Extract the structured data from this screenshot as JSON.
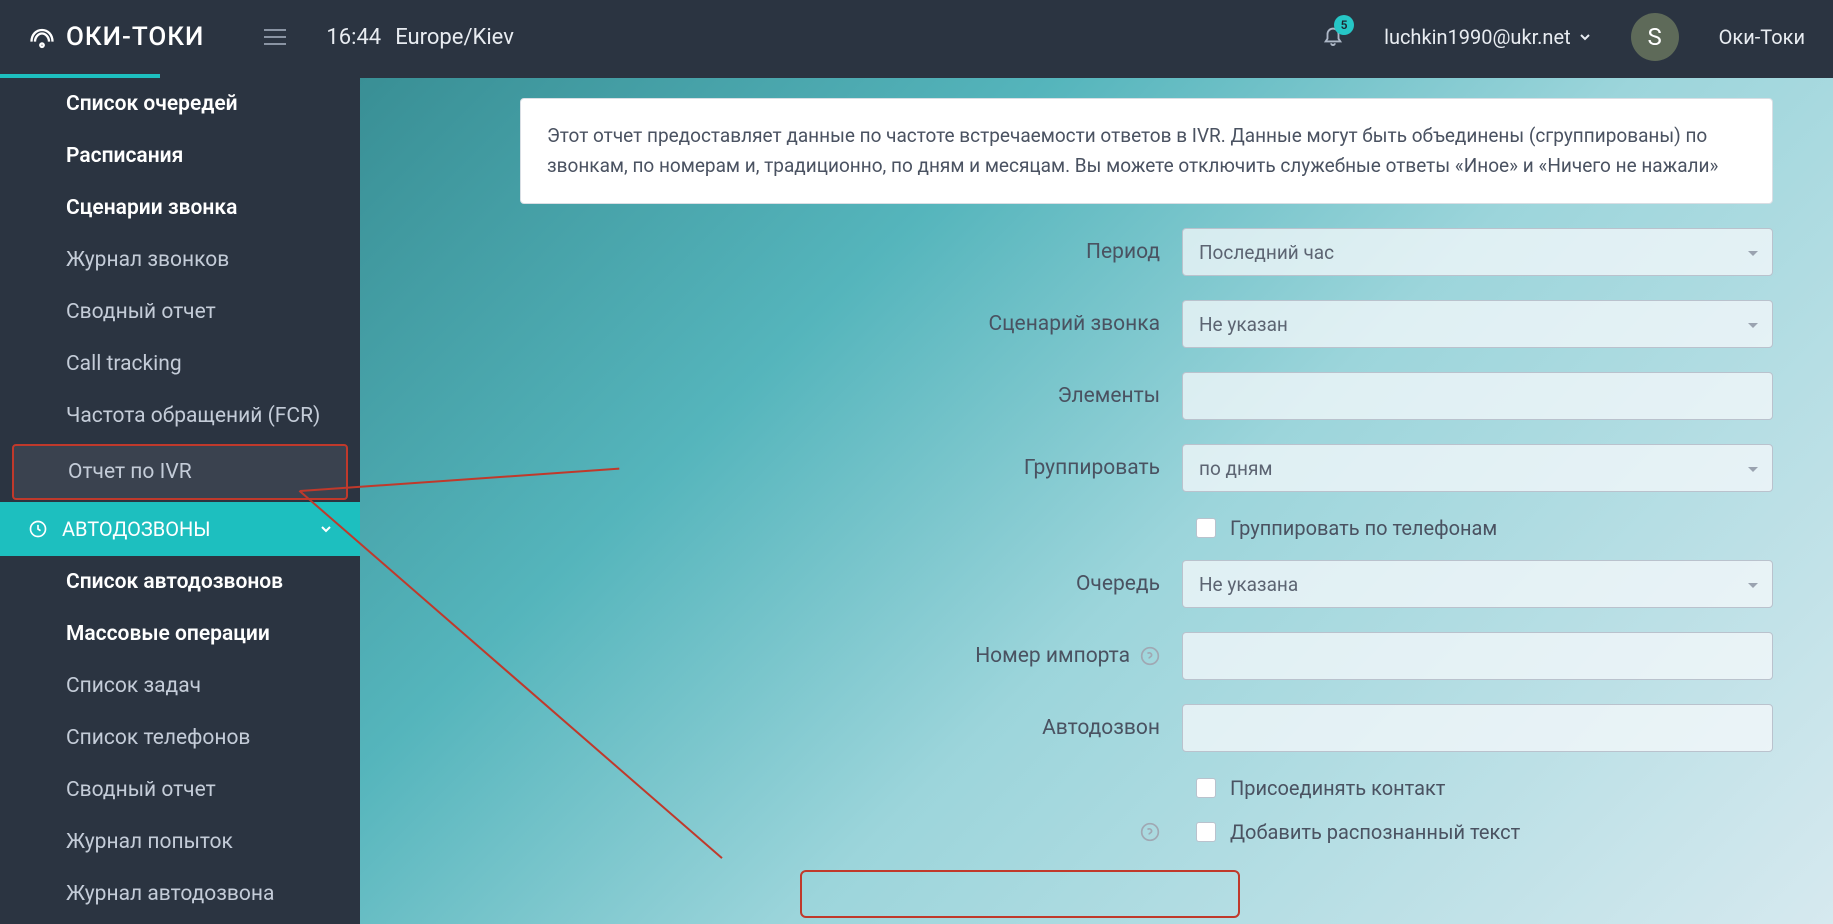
{
  "header": {
    "logo_text": "ОКИ-ТОКИ",
    "time": "16:44",
    "timezone": "Europe/Kiev",
    "badge_count": "5",
    "user_email": "luchkin1990@ukr.net",
    "avatar_letter": "S",
    "company": "Оки-Токи"
  },
  "sidebar": {
    "items": [
      {
        "label": "Список очередей",
        "bold": true
      },
      {
        "label": "Расписания",
        "bold": true
      },
      {
        "label": "Сценарии звонка",
        "bold": true
      },
      {
        "label": "Журнал звонков",
        "bold": false
      },
      {
        "label": "Сводный отчет",
        "bold": false
      },
      {
        "label": "Call tracking",
        "bold": false
      },
      {
        "label": "Частота обращений (FCR)",
        "bold": false
      },
      {
        "label": "Отчет по IVR",
        "bold": false,
        "highlight": true
      }
    ],
    "group_title": "АВТОДОЗВОНЫ",
    "items2": [
      {
        "label": "Список автодозвонов",
        "bold": true
      },
      {
        "label": "Массовые операции",
        "bold": true
      },
      {
        "label": "Список задач",
        "bold": false
      },
      {
        "label": "Список телефонов",
        "bold": false
      },
      {
        "label": "Сводный отчет",
        "bold": false
      },
      {
        "label": "Журнал попыток",
        "bold": false
      },
      {
        "label": "Журнал автодозвона",
        "bold": false
      }
    ]
  },
  "info_text": "Этот отчет предоставляет данные по частоте встречаемости ответов в IVR. Данные могут быть объединены (сгруппированы) по звонкам, по номерам и, традиционно, по дням и месяцам. Вы можете отключить служебные ответы «Иное» и «Ничего не нажали»",
  "form": {
    "period_label": "Период",
    "period_value": "Последний час",
    "scenario_label": "Сценарий звонка",
    "scenario_value": "Не указан",
    "elements_label": "Элементы",
    "group_label": "Группировать",
    "group_value": "по дням",
    "group_phone_label": "Группировать по телефонам",
    "queue_label": "Очередь",
    "queue_value": "Не указана",
    "import_label": "Номер импорта",
    "autodial_label": "Автодозвон",
    "attach_contact_label": "Присоединять контакт",
    "recognized_text_label": "Добавить распознанный текст"
  }
}
